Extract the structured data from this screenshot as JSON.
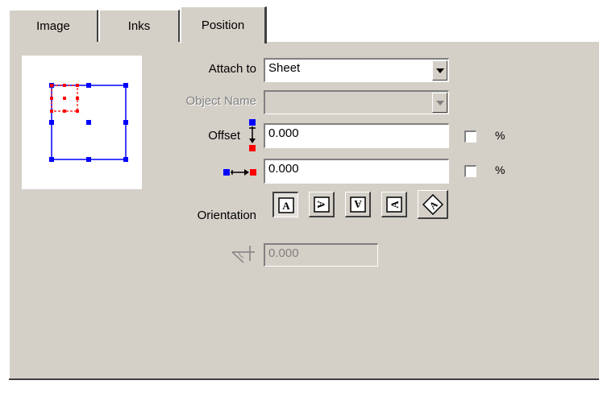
{
  "tabs": [
    {
      "label": "Image"
    },
    {
      "label": "Inks"
    },
    {
      "label": "Position",
      "active": true
    }
  ],
  "form": {
    "attach_label": "Attach to",
    "attach_value": "Sheet",
    "object_name_label": "Object Name",
    "object_name_value": "",
    "offset_label": "Offset",
    "offset_vertical_value": "0.000",
    "offset_vertical_percent_checked": false,
    "offset_horizontal_value": "0.000",
    "offset_horizontal_percent_checked": false,
    "percent_symbol": "%",
    "orientation_label": "Orientation",
    "orientation_buttons": [
      "orientation-normal",
      "orientation-rotate-right",
      "orientation-upside-down",
      "orientation-rotate-left",
      "orientation-diamond"
    ],
    "angle_value": "0.000"
  },
  "colors": {
    "panel": "#d4d0c8",
    "preview_blue": "#0000ff",
    "preview_red": "#ff0000"
  }
}
